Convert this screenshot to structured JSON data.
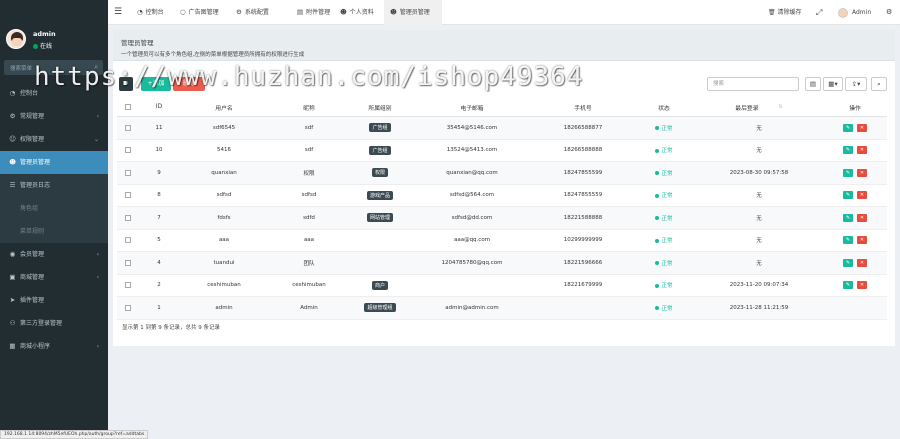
{
  "sidebar": {
    "user": {
      "name": "admin",
      "status": "在线"
    },
    "search_placeholder": "搜索菜单",
    "items": [
      {
        "label": "控制台",
        "icon": "dashboard-icon",
        "arrow": "",
        "style": "normal"
      },
      {
        "label": "常规管理",
        "icon": "cogs-icon",
        "arrow": "‹",
        "style": "normal"
      },
      {
        "label": "权限管理",
        "icon": "group-icon",
        "arrow": "⌄",
        "style": "normal"
      },
      {
        "label": "管理员管理",
        "icon": "user-icon",
        "arrow": "",
        "style": "active"
      },
      {
        "label": "管理员日志",
        "icon": "list-icon",
        "arrow": "",
        "style": "sub"
      },
      {
        "label": "角色组",
        "icon": "",
        "arrow": "",
        "style": "dim"
      },
      {
        "label": "菜单规则",
        "icon": "",
        "arrow": "",
        "style": "dim"
      },
      {
        "label": "会员管理",
        "icon": "user-circle-icon",
        "arrow": "‹",
        "style": "normal"
      },
      {
        "label": "商城管理",
        "icon": "shop-icon",
        "arrow": "‹",
        "style": "normal"
      },
      {
        "label": "插件管理",
        "icon": "rocket-icon",
        "arrow": "",
        "style": "normal"
      },
      {
        "label": "第三方登录管理",
        "icon": "users-icon",
        "arrow": "",
        "style": "normal"
      },
      {
        "label": "商城小程序",
        "icon": "grid-icon",
        "arrow": "‹",
        "style": "normal"
      }
    ]
  },
  "topbar": {
    "tabs": [
      {
        "label": "控制台",
        "icon": "dashboard-icon",
        "active": false
      },
      {
        "label": "广告图管理",
        "icon": "circle-icon",
        "active": false
      },
      {
        "label": "系统配置",
        "icon": "cog-icon",
        "active": false
      },
      {
        "label": "附件管理",
        "icon": "file-icon",
        "active": false
      },
      {
        "label": "个人资料",
        "icon": "user-icon",
        "active": false
      },
      {
        "label": "管理员管理",
        "icon": "user-icon",
        "active": true
      }
    ],
    "clear_cache": "清除缓存",
    "admin_label": "Admin"
  },
  "panel": {
    "title": "管理员管理",
    "description": "一个管理员可以有多个角色组,左侧的菜单根据管理员所拥有的权限进行生成"
  },
  "toolbar": {
    "refresh": "↻",
    "add": "+添加",
    "delete": "删除",
    "search_placeholder": "搜索"
  },
  "table": {
    "headers": [
      "ID",
      "用户名",
      "昵称",
      "所属组别",
      "电子邮箱",
      "手机号",
      "状态",
      "最后登录",
      "操作"
    ],
    "rows": [
      {
        "id": "11",
        "username": "sdf6545",
        "nickname": "sdf",
        "group": "广告组",
        "email": "35454@5146.com",
        "mobile": "18266588877",
        "status": "正常",
        "last_login": "无"
      },
      {
        "id": "10",
        "username": "5416",
        "nickname": "sdf",
        "group": "广告组",
        "email": "13524@5413.com",
        "mobile": "18266588888",
        "status": "正常",
        "last_login": "无"
      },
      {
        "id": "9",
        "username": "quanxian",
        "nickname": "权限",
        "group": "权限",
        "email": "quanxian@qq.com",
        "mobile": "18247855599",
        "status": "正常",
        "last_login": "2023-08-30 09:57:58"
      },
      {
        "id": "8",
        "username": "sdfsd",
        "nickname": "sdfsd",
        "group": "游戏产品",
        "email": "sdfsd@564.com",
        "mobile": "18247855559",
        "status": "正常",
        "last_login": "无"
      },
      {
        "id": "7",
        "username": "fdsfs",
        "nickname": "sdfd",
        "group": "网站管理",
        "email": "sdfsd@dd.com",
        "mobile": "18221588888",
        "status": "正常",
        "last_login": "无"
      },
      {
        "id": "5",
        "username": "aaa",
        "nickname": "aaa",
        "group": "",
        "email": "aaa@qq.com",
        "mobile": "10299999999",
        "status": "正常",
        "last_login": "无"
      },
      {
        "id": "4",
        "username": "tuandui",
        "nickname": "团队",
        "group": "",
        "email": "1204785780@qq.com",
        "mobile": "18221596666",
        "status": "正常",
        "last_login": "无"
      },
      {
        "id": "2",
        "username": "ceshimuban",
        "nickname": "ceshimuban",
        "group": "商户",
        "email": "",
        "mobile": "18221679999",
        "status": "正常",
        "last_login": "2023-11-20 09:07:34"
      },
      {
        "id": "1",
        "username": "admin",
        "nickname": "Admin",
        "group": "超级管理组",
        "email": "admin@admin.com",
        "mobile": "",
        "status": "正常",
        "last_login": "2023-11-28 11:21:59"
      }
    ]
  },
  "footer": {
    "info": "显示第 1 到第 9 条记录，总共 9 条记录"
  },
  "watermark": "https://www.huzhan.com/ishop49364",
  "status_url": "192.168.1.14:8094/zhM5efUEOh.php/auth/group?ref=addtabs",
  "colors": {
    "sidebar_bg": "#222d32",
    "active": "#3c8dbc",
    "success": "#18bc9c",
    "danger": "#e74c3c"
  }
}
